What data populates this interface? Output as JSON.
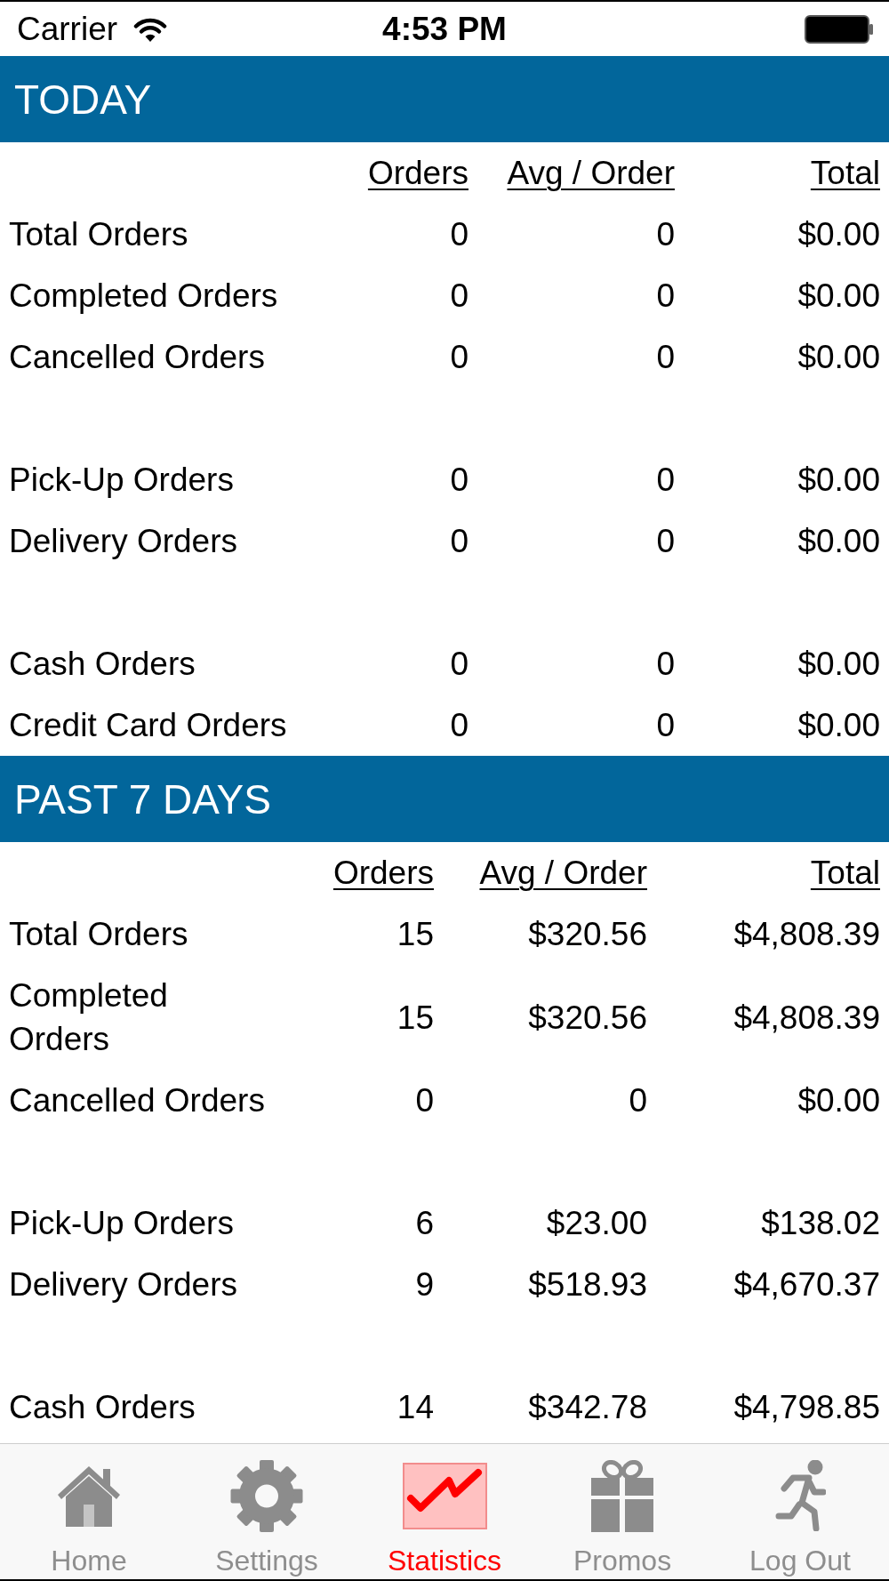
{
  "status_bar": {
    "carrier": "Carrier",
    "time": "4:53 PM"
  },
  "sections": [
    {
      "title": "TODAY",
      "columns": [
        "Orders",
        "Avg / Order",
        "Total"
      ],
      "groups": [
        [
          {
            "label": "Total Orders",
            "orders": "0",
            "avg_per_order": "0",
            "total": "$0.00"
          },
          {
            "label": "Completed Orders",
            "orders": "0",
            "avg_per_order": "0",
            "total": "$0.00"
          },
          {
            "label": "Cancelled Orders",
            "orders": "0",
            "avg_per_order": "0",
            "total": "$0.00"
          }
        ],
        [
          {
            "label": "Pick-Up Orders",
            "orders": "0",
            "avg_per_order": "0",
            "total": "$0.00"
          },
          {
            "label": "Delivery Orders",
            "orders": "0",
            "avg_per_order": "0",
            "total": "$0.00"
          }
        ],
        [
          {
            "label": "Cash Orders",
            "orders": "0",
            "avg_per_order": "0",
            "total": "$0.00"
          },
          {
            "label": "Credit Card Orders",
            "orders": "0",
            "avg_per_order": "0",
            "total": "$0.00"
          }
        ]
      ]
    },
    {
      "title": "PAST 7 DAYS",
      "columns": [
        "Orders",
        "Avg / Order",
        "Total"
      ],
      "groups": [
        [
          {
            "label": "Total Orders",
            "orders": "15",
            "avg_per_order": "$320.56",
            "total": "$4,808.39"
          },
          {
            "label": "Completed Orders",
            "orders": "15",
            "avg_per_order": "$320.56",
            "total": "$4,808.39"
          },
          {
            "label": "Cancelled Orders",
            "orders": "0",
            "avg_per_order": "0",
            "total": "$0.00"
          }
        ],
        [
          {
            "label": "Pick-Up Orders",
            "orders": "6",
            "avg_per_order": "$23.00",
            "total": "$138.02"
          },
          {
            "label": "Delivery Orders",
            "orders": "9",
            "avg_per_order": "$518.93",
            "total": "$4,670.37"
          }
        ],
        [
          {
            "label": "Cash Orders",
            "orders": "14",
            "avg_per_order": "$342.78",
            "total": "$4,798.85"
          }
        ]
      ]
    }
  ],
  "tab_bar": [
    {
      "label": "Home",
      "selected": false
    },
    {
      "label": "Settings",
      "selected": false
    },
    {
      "label": "Statistics",
      "selected": true
    },
    {
      "label": "Promos",
      "selected": false
    },
    {
      "label": "Log Out",
      "selected": false
    }
  ]
}
